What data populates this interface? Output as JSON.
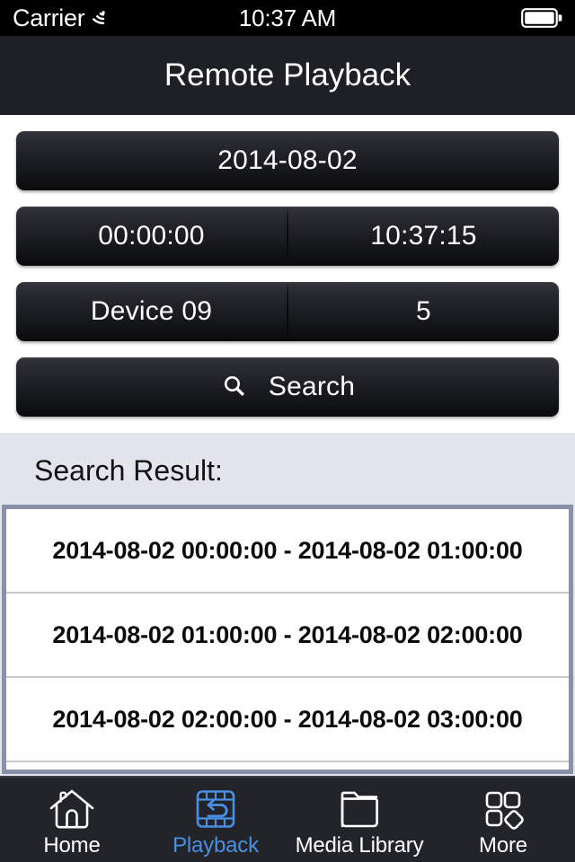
{
  "status_bar": {
    "carrier": "Carrier",
    "wifi_icon": "wifi-icon",
    "time": "10:37 AM",
    "battery_icon": "battery-full-icon"
  },
  "nav_bar": {
    "title": "Remote Playback"
  },
  "form": {
    "date_button": {
      "label": "2014-08-02"
    },
    "time_row": {
      "start_label": "00:00:00",
      "end_label": "10:37:15"
    },
    "device_row": {
      "device_label": "Device 09",
      "channel_label": "5"
    },
    "search_button": {
      "icon": "search-icon",
      "label": "Search"
    }
  },
  "results": {
    "title": "Search Result:",
    "rows": [
      "2014-08-02 00:00:00 - 2014-08-02 01:00:00",
      "2014-08-02 01:00:00 - 2014-08-02 02:00:00",
      "2014-08-02 02:00:00 - 2014-08-02 03:00:00"
    ]
  },
  "tab_bar": {
    "active_index": 1,
    "accent_color": "#4a90e2",
    "items": [
      {
        "label": "Home",
        "icon": "home-icon"
      },
      {
        "label": "Playback",
        "icon": "film-loop-icon"
      },
      {
        "label": "Media Library",
        "icon": "folder-icon"
      },
      {
        "label": "More",
        "icon": "grid-more-icon"
      }
    ]
  }
}
